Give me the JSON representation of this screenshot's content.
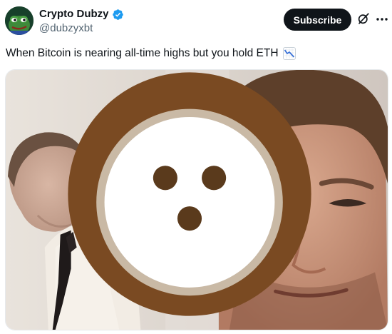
{
  "post": {
    "author": {
      "display_name": "Crypto Dubzy",
      "handle": "@dubzyxbt",
      "verified": true,
      "avatar_icon": "pepe-frog-avatar"
    },
    "subscribe_label": "Subscribe",
    "text": "When Bitcoin is nearing all-time highs but you hold ETH",
    "text_emoji": "chart-decreasing-icon",
    "media": {
      "type": "image",
      "badge_icon": "coconut-icon"
    }
  },
  "colors": {
    "verified_blue": "#1d9bf0",
    "text_primary": "#0f1419",
    "text_secondary": "#536471",
    "button_bg": "#0f1419"
  }
}
